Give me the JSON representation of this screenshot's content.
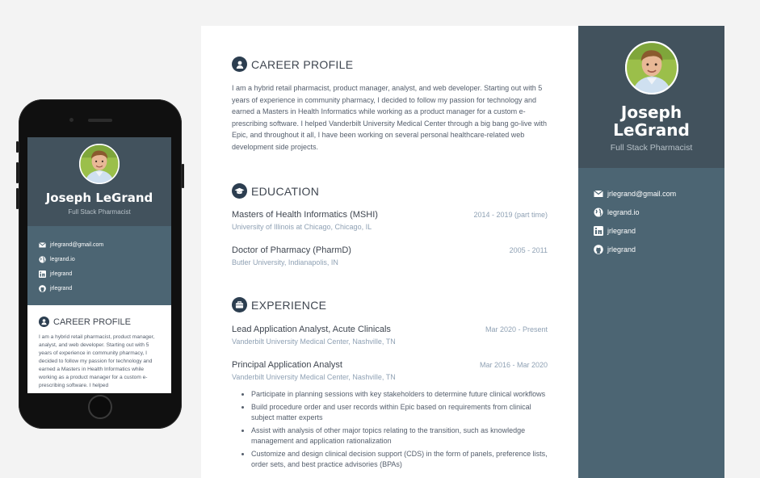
{
  "profile": {
    "first_name": "Joseph",
    "last_name": "LeGrand",
    "full_name": "Joseph LeGrand",
    "tagline": "Full Stack Pharmacist"
  },
  "contacts": [
    {
      "icon": "envelope-icon",
      "text": "jrlegrand@gmail.com"
    },
    {
      "icon": "globe-icon",
      "text": "legrand.io"
    },
    {
      "icon": "linkedin-icon",
      "text": "jrlegrand"
    },
    {
      "icon": "github-icon",
      "text": "jrlegrand"
    }
  ],
  "career_profile": {
    "heading": "CAREER PROFILE",
    "text": "I am a hybrid retail pharmacist, product manager, analyst, and web developer. Starting out with 5 years of experience in community pharmacy, I decided to follow my passion for technology and earned a Masters in Health Informatics while working as a product manager for a custom e-prescribing software. I helped Vanderbilt University Medical Center through a big bang go-live with Epic, and throughout it all, I have been working on several personal healthcare-related web development side projects."
  },
  "education": {
    "heading": "EDUCATION",
    "items": [
      {
        "degree": "Masters of Health Informatics (MSHI)",
        "school": "University of Illinois at Chicago, Chicago, IL",
        "dates": "2014 - 2019 (part time)"
      },
      {
        "degree": "Doctor of Pharmacy (PharmD)",
        "school": "Butler University, Indianapolis, IN",
        "dates": "2005 - 2011"
      }
    ]
  },
  "experience": {
    "heading": "EXPERIENCE",
    "items": [
      {
        "title": "Lead Application Analyst, Acute Clinicals",
        "org": "Vanderbilt University Medical Center, Nashville, TN",
        "dates": "Mar 2020 - Present"
      },
      {
        "title": "Principal Application Analyst",
        "org": "Vanderbilt University Medical Center, Nashville, TN",
        "dates": "Mar 2016 - Mar 2020",
        "bullets": [
          "Participate in planning sessions with key stakeholders to determine future clinical workflows",
          "Build procedure order and user records within Epic based on requirements from clinical subject matter experts",
          "Assist with analysis of other major topics relating to the transition, such as knowledge management and application rationalization",
          "Customize and design clinical decision support (CDS) in the form of panels, preference lists, order sets, and best practice advisories (BPAs)"
        ]
      }
    ]
  },
  "mobile": {
    "career_text": "I am a hybrid retail pharmacist, product manager, analyst, and web developer. Starting out with 5 years of experience in community pharmacy, I decided to follow my passion for technology and earned a Masters in Health Informatics while working as a product manager for a custom e-prescribing software. I helped"
  },
  "colors": {
    "sidebar_dark": "#42525d",
    "sidebar": "#4c6573",
    "badge": "#2c3e50",
    "muted_blue": "#8fa1b4",
    "background": "#f3f3f3"
  }
}
